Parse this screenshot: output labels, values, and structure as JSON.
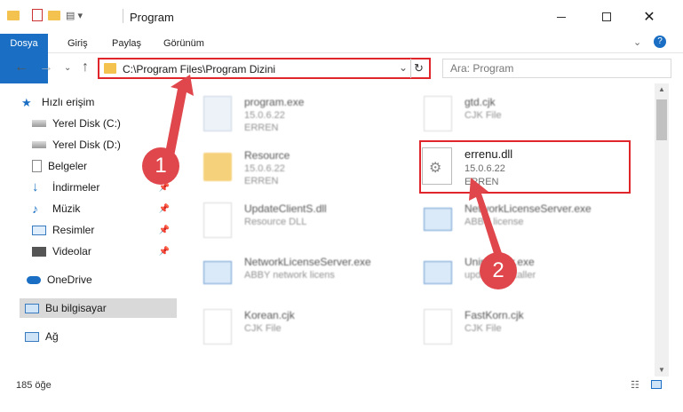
{
  "window": {
    "title": "Program"
  },
  "ribbon": {
    "tabs": [
      "Dosya",
      "Giriş",
      "Paylaş",
      "Görünüm"
    ]
  },
  "address": {
    "path": "C:\\Program Files\\Program Dizini"
  },
  "search": {
    "placeholder": "Ara: Program"
  },
  "sidebar": {
    "items": [
      {
        "label": "Hızlı erişim",
        "icon": "star-icon"
      },
      {
        "label": "Yerel Disk (C:)",
        "icon": "drive-icon"
      },
      {
        "label": "Yerel Disk (D:)",
        "icon": "drive-icon"
      },
      {
        "label": "Belgeler",
        "icon": "documents-icon"
      },
      {
        "label": "İndirmeler",
        "icon": "download-icon"
      },
      {
        "label": "Müzik",
        "icon": "music-icon"
      },
      {
        "label": "Resimler",
        "icon": "pictures-icon"
      },
      {
        "label": "Videolar",
        "icon": "videos-icon"
      },
      {
        "label": "OneDrive",
        "icon": "onedrive-icon"
      },
      {
        "label": "Bu bilgisayar",
        "icon": "computer-icon"
      },
      {
        "label": "Ağ",
        "icon": "network-icon"
      }
    ]
  },
  "files": [
    {
      "name": "program.exe",
      "line1": "15.0.6.22",
      "line2": "ERREN"
    },
    {
      "name": "gtd.cjk",
      "line1": "CJK File",
      "line2": ""
    },
    {
      "name": "Resource",
      "line1": "15.0.6.22",
      "line2": "ERREN"
    },
    {
      "name": "errenu.dll",
      "line1": "15.0.6.22",
      "line2": "ERREN"
    },
    {
      "name": "UpdateClientS.dll",
      "line1": "Resource DLL",
      "line2": ""
    },
    {
      "name": "NetworkLicenseServer.exe",
      "line1": "ABBY license",
      "line2": ""
    },
    {
      "name": "NetworkLicenseServer.exe",
      "line1": "ABBY network licens",
      "line2": ""
    },
    {
      "name": "Uninstaller.exe",
      "line1": "updates installer",
      "line2": ""
    },
    {
      "name": "Korean.cjk",
      "line1": "CJK File",
      "line2": ""
    },
    {
      "name": "FastKorn.cjk",
      "line1": "CJK File",
      "line2": ""
    }
  ],
  "markers": [
    "1",
    "2"
  ],
  "status": {
    "count": "185 öğe"
  },
  "colors": {
    "accent": "#1a6fc4",
    "highlight": "#e0262b",
    "marker": "#e0474c"
  }
}
